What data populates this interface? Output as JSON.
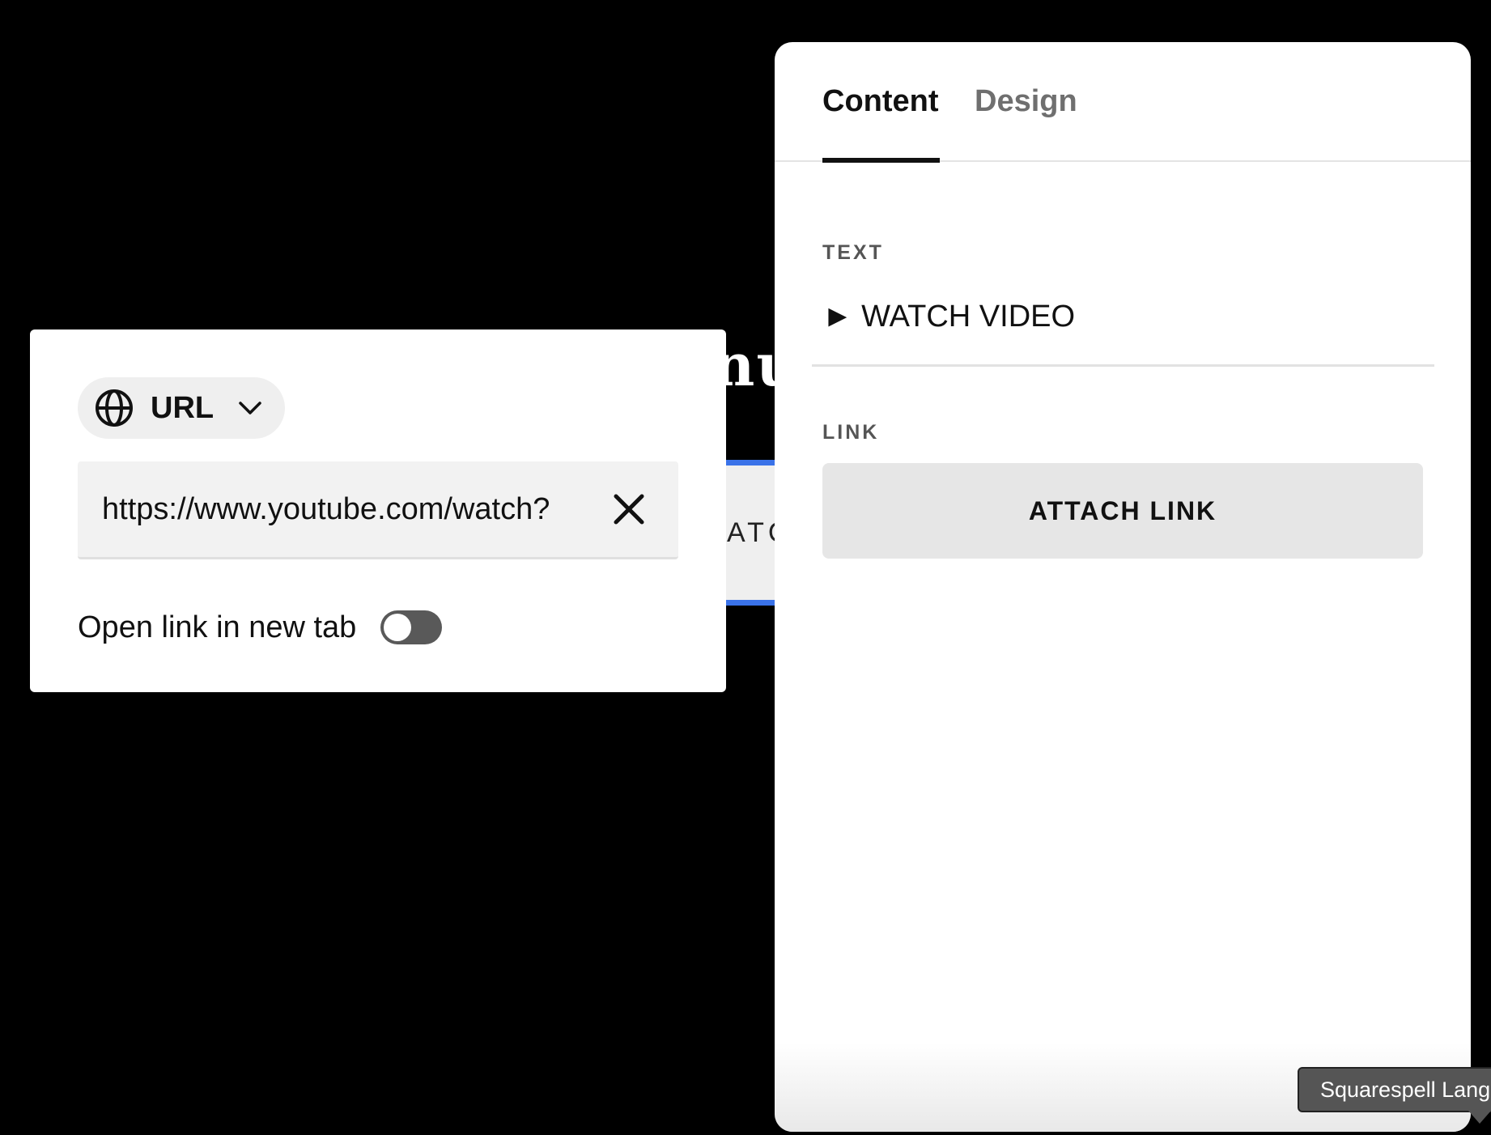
{
  "background": {
    "heading_fragment": "nu",
    "button_fragment": "ATC"
  },
  "panel": {
    "tabs": [
      {
        "label": "Content",
        "active": true
      },
      {
        "label": "Design",
        "active": false
      }
    ],
    "text_section": {
      "label": "TEXT",
      "value": "► WATCH VIDEO"
    },
    "link_section": {
      "label": "LINK",
      "button_label": "ATTACH LINK"
    }
  },
  "link_popup": {
    "type_selector": {
      "icon": "globe-icon",
      "label": "URL",
      "chevron_icon": "chevron-down-icon"
    },
    "url_field": {
      "value": "https://www.youtube.com/watch?",
      "clear_icon": "close-icon"
    },
    "new_tab": {
      "label": "Open link in new tab",
      "enabled": false
    }
  },
  "tooltip": {
    "text": "Squarespell Lang"
  },
  "colors": {
    "accent_blue": "#3a72e8",
    "toggle_off": "#595959",
    "tooltip_bg": "#555555"
  }
}
